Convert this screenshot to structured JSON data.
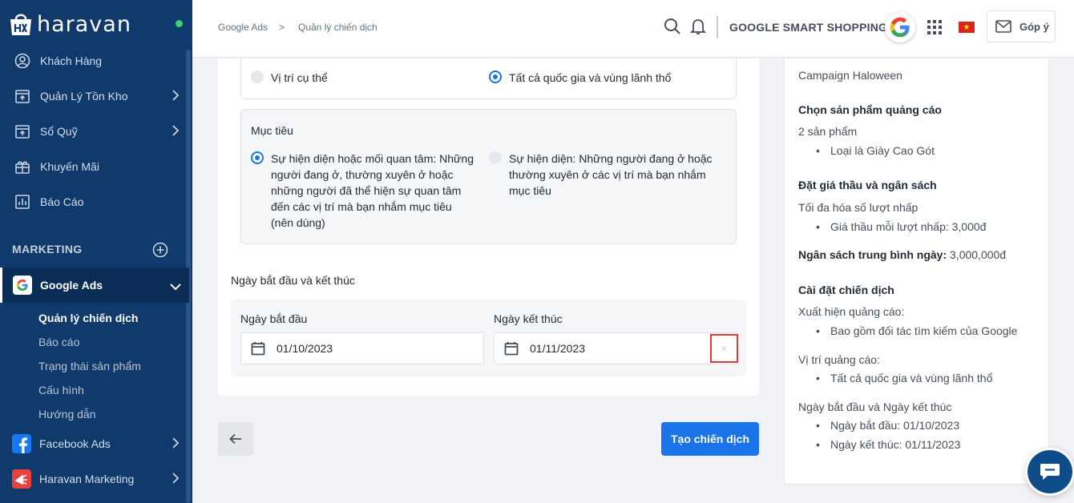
{
  "brand": {
    "name": "haravan"
  },
  "sidebar": {
    "items": [
      {
        "label": "Khách Hàng",
        "icon": "user-circle-icon",
        "chevron": false
      },
      {
        "label": "Quản Lý Tồn Kho",
        "icon": "inventory-icon",
        "chevron": true
      },
      {
        "label": "Sổ Quỹ",
        "icon": "cashbook-icon",
        "chevron": true
      },
      {
        "label": "Khuyến Mãi",
        "icon": "gift-icon",
        "chevron": false
      },
      {
        "label": "Báo Cáo",
        "icon": "report-icon",
        "chevron": false
      }
    ],
    "section_title": "MARKETING",
    "active": {
      "label": "Google Ads",
      "icon": "google-icon"
    },
    "sub_items": [
      "Quản lý chiến dịch",
      "Báo cáo",
      "Trạng thái sản phẩm",
      "Cấu hình",
      "Hướng dẫn"
    ],
    "bottom_items": [
      {
        "label": "Facebook Ads",
        "icon": "facebook-icon",
        "color": "#1877f2"
      },
      {
        "label": "Haravan Marketing",
        "icon": "haravan-marketing-icon",
        "color": "#e8413e"
      }
    ]
  },
  "header": {
    "breadcrumb": [
      "Google Ads",
      "Quản lý chiến dịch"
    ],
    "separator": ">",
    "shop_name": "GOOGLE SMART SHOPPING",
    "feedback_label": "Góp ý",
    "flag_star": "★"
  },
  "form": {
    "location_options": [
      {
        "label": "Vị trí cụ thể",
        "selected": false
      },
      {
        "label": "Tất cả quốc gia và vùng lãnh thổ",
        "selected": true
      }
    ],
    "goal_title": "Mục tiêu",
    "goal_options": [
      {
        "lines": [
          "Sự hiện diện hoặc mối quan tâm: Những",
          "người đang ở, thường xuyên ở hoặc",
          "những người đã thể hiện sự quan tâm",
          "đến các vị trí mà bạn nhắm mục tiêu",
          "(nên dùng)"
        ],
        "selected": true
      },
      {
        "lines": [
          "Sự hiện diện: Những người đang ở hoặc",
          "thường xuyên ở các vị trí mà bạn nhắm",
          "mục tiêu"
        ],
        "selected": false
      }
    ],
    "dates_title": "Ngày bắt đầu và kết thúc",
    "start_label": "Ngày bắt đầu",
    "start_value": "01/10/2023",
    "end_label": "Ngày kết thúc",
    "end_value": "01/11/2023",
    "clear_symbol": "×",
    "create_label": "Tạo chiến dịch"
  },
  "summary": {
    "campaign_name": "Campaign Haloween",
    "products_title": "Chọn sản phẩm quảng cáo",
    "products_count": "2 sản phẩm",
    "products_bullet": "Loại là Giày Cao Gót",
    "bid_title": "Đặt giá thầu và ngân sách",
    "bid_strategy": "Tối đa hóa số lượt nhấp",
    "bid_bullet": "Giá thầu mỗi lượt nhấp: 3,000đ",
    "budget_label": "Ngân sách trung bình ngày:",
    "budget_value": "3,000,000đ",
    "settings_title": "Cài đặt chiến dịch",
    "appear_label": "Xuất hiện quảng cáo:",
    "appear_bullet": "Bao gồm đối tác tìm kiếm của Google",
    "location_label": "Vị trí quảng cáo:",
    "location_bullet": "Tất cả quốc gia và vùng lãnh thổ",
    "dates_label": "Ngày bắt đầu và Ngày kết thúc",
    "start_bullet": "Ngày bắt đầu: 01/10/2023",
    "end_bullet": "Ngày kết thúc: 01/11/2023"
  }
}
